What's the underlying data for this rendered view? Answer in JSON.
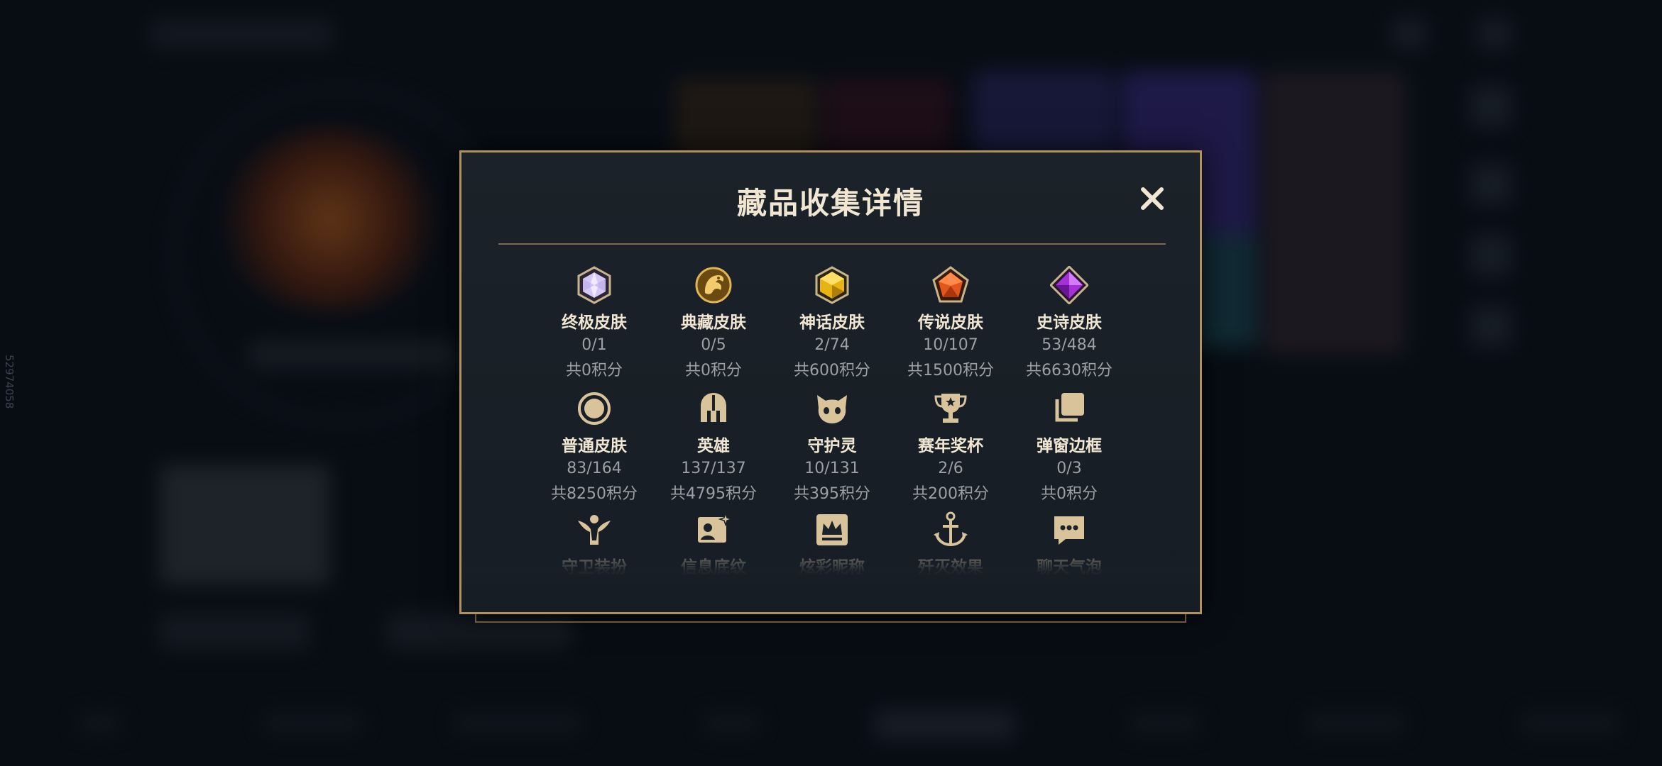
{
  "modal": {
    "title": "藏品收集详情",
    "close_label": "✕"
  },
  "rows": [
    [
      {
        "icon": "ultimate-skin-gem-icon",
        "name": "终极皮肤",
        "count": "0/1",
        "points": "共0积分"
      },
      {
        "icon": "prestige-skin-dragon-icon",
        "name": "典藏皮肤",
        "count": "0/5",
        "points": "共0积分"
      },
      {
        "icon": "mythic-skin-gem-icon",
        "name": "神话皮肤",
        "count": "2/74",
        "points": "共600积分"
      },
      {
        "icon": "legendary-skin-gem-icon",
        "name": "传说皮肤",
        "count": "10/107",
        "points": "共1500积分"
      },
      {
        "icon": "epic-skin-gem-icon",
        "name": "史诗皮肤",
        "count": "53/484",
        "points": "共6630积分"
      }
    ],
    [
      {
        "icon": "standard-skin-circle-icon",
        "name": "普通皮肤",
        "count": "83/164",
        "points": "共8250积分"
      },
      {
        "icon": "champion-helmet-icon",
        "name": "英雄",
        "count": "137/137",
        "points": "共4795积分"
      },
      {
        "icon": "little-legend-icon",
        "name": "守护灵",
        "count": "10/131",
        "points": "共395积分"
      },
      {
        "icon": "trophy-icon",
        "name": "赛年奖杯",
        "count": "2/6",
        "points": "共200积分"
      },
      {
        "icon": "popup-frame-icon",
        "name": "弹窗边框",
        "count": "0/3",
        "points": "共0积分"
      }
    ],
    [
      {
        "icon": "guardian-outfit-icon",
        "name": "守卫装扮"
      },
      {
        "icon": "profile-banner-icon",
        "name": "信息底纹"
      },
      {
        "icon": "colorful-nickname-icon",
        "name": "炫彩昵称"
      },
      {
        "icon": "ace-effect-anchor-icon",
        "name": "歼灭效果"
      },
      {
        "icon": "chat-bubble-icon",
        "name": "聊天气泡"
      }
    ]
  ],
  "background": {
    "side_id": "52974058"
  },
  "colors": {
    "gold_border": "#b0925a",
    "title_text": "#f0e6d2",
    "sub_text": "#9aa0a6",
    "icon_gold": "#d8c39a"
  }
}
